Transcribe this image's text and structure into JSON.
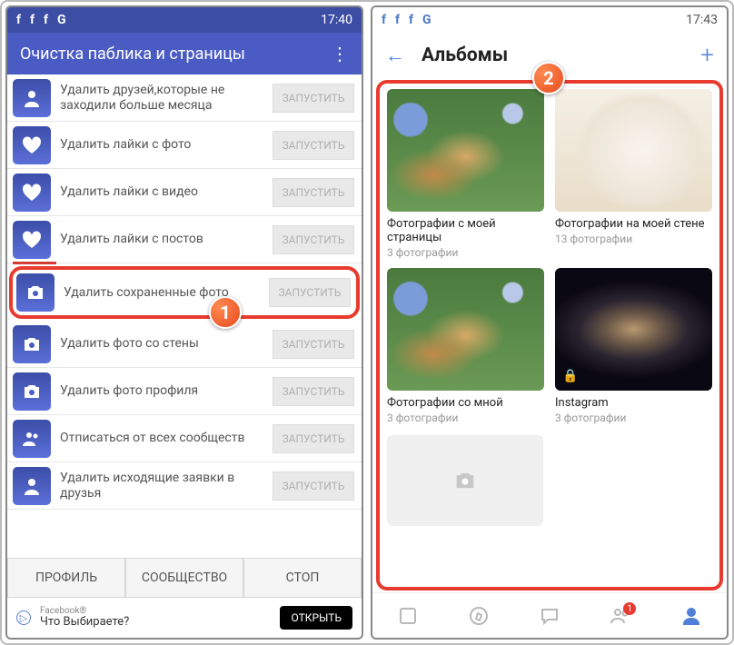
{
  "left": {
    "status": {
      "time": "17:40",
      "icons": [
        "f",
        "f",
        "f",
        "G"
      ]
    },
    "title": "Очистка паблика и страницы",
    "rows": [
      {
        "icon": "person-down",
        "label": "Удалить друзей,которые не заходили больше месяца",
        "btn": "ЗАПУСТИТЬ"
      },
      {
        "icon": "heart",
        "label": "Удалить лайки с фото",
        "btn": "ЗАПУСТИТЬ"
      },
      {
        "icon": "heart",
        "label": "Удалить лайки с видео",
        "btn": "ЗАПУСТИТЬ"
      },
      {
        "icon": "heart",
        "label": "Удалить лайки с постов",
        "btn": "ЗАПУСТИТЬ"
      },
      {
        "icon": "camera",
        "label": "Удалить сохраненные фото",
        "btn": "ЗАПУСТИТЬ",
        "highlight": true
      },
      {
        "icon": "camera",
        "label": "Удалить фото со стены",
        "btn": "ЗАПУСТИТЬ"
      },
      {
        "icon": "camera",
        "label": "Удалить фото профиля",
        "btn": "ЗАПУСТИТЬ"
      },
      {
        "icon": "people",
        "label": "Отписаться от всех сообществ",
        "btn": "ЗАПУСТИТЬ"
      },
      {
        "icon": "person-up",
        "label": "Удалить исходящие заявки в друзья",
        "btn": "ЗАПУСТИТЬ"
      }
    ],
    "tabs": {
      "profile": "ПРОФИЛЬ",
      "community": "СООБЩЕСТВО",
      "stop": "СТОП"
    },
    "ad": {
      "sub": "Facebook®",
      "title": "Что Выбираете?",
      "btn": "ОТКРЫТЬ"
    },
    "callout": "1"
  },
  "right": {
    "status": {
      "time": "17:43",
      "icons": [
        "f",
        "f",
        "f",
        "G"
      ]
    },
    "header": {
      "title": "Альбомы"
    },
    "callout": "2",
    "albums": [
      {
        "thumb": "dog",
        "title": "Фотографии с моей страницы",
        "sub": "3 фотографии"
      },
      {
        "thumb": "whitedog",
        "title": "Фотографии на моей стене",
        "sub": "13 фотографии"
      },
      {
        "thumb": "dog",
        "title": "Фотографии со мной",
        "sub": "3 фотографии"
      },
      {
        "thumb": "galaxy",
        "title": "Instagram",
        "sub": "3 фотографии",
        "lock": true
      }
    ],
    "bottombar_badge": "1"
  }
}
